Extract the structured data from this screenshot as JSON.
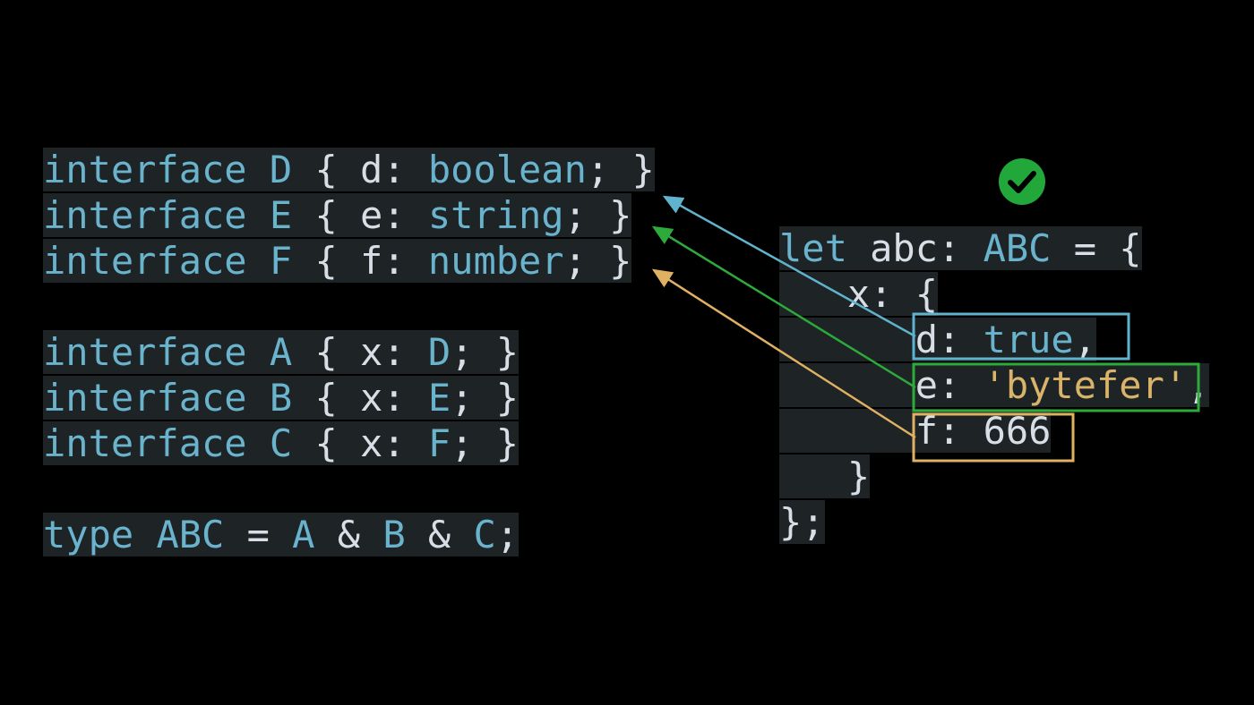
{
  "left_code": {
    "block1": [
      [
        {
          "t": "interface",
          "c": "kw"
        },
        {
          "t": " D ",
          "c": "ty"
        },
        {
          "t": "{ d: ",
          "c": "pu"
        },
        {
          "t": "boolean",
          "c": "kw"
        },
        {
          "t": "; }",
          "c": "pu"
        }
      ],
      [
        {
          "t": "interface",
          "c": "kw"
        },
        {
          "t": " E ",
          "c": "ty"
        },
        {
          "t": "{ e: ",
          "c": "pu"
        },
        {
          "t": "string",
          "c": "kw"
        },
        {
          "t": "; }",
          "c": "pu"
        }
      ],
      [
        {
          "t": "interface",
          "c": "kw"
        },
        {
          "t": " F ",
          "c": "ty"
        },
        {
          "t": "{ f: ",
          "c": "pu"
        },
        {
          "t": "number",
          "c": "kw"
        },
        {
          "t": "; }",
          "c": "pu"
        }
      ]
    ],
    "block2": [
      [
        {
          "t": "interface",
          "c": "kw"
        },
        {
          "t": " A ",
          "c": "ty"
        },
        {
          "t": "{ x: ",
          "c": "pu"
        },
        {
          "t": "D",
          "c": "ty"
        },
        {
          "t": "; }",
          "c": "pu"
        }
      ],
      [
        {
          "t": "interface",
          "c": "kw"
        },
        {
          "t": " B ",
          "c": "ty"
        },
        {
          "t": "{ x: ",
          "c": "pu"
        },
        {
          "t": "E",
          "c": "ty"
        },
        {
          "t": "; }",
          "c": "pu"
        }
      ],
      [
        {
          "t": "interface",
          "c": "kw"
        },
        {
          "t": " C ",
          "c": "ty"
        },
        {
          "t": "{ x: ",
          "c": "pu"
        },
        {
          "t": "F",
          "c": "ty"
        },
        {
          "t": "; }",
          "c": "pu"
        }
      ]
    ],
    "block3": [
      [
        {
          "t": "type",
          "c": "kw"
        },
        {
          "t": " ABC ",
          "c": "ty"
        },
        {
          "t": "= ",
          "c": "pu"
        },
        {
          "t": "A",
          "c": "ty"
        },
        {
          "t": " & ",
          "c": "pu"
        },
        {
          "t": "B",
          "c": "ty"
        },
        {
          "t": " & ",
          "c": "pu"
        },
        {
          "t": "C",
          "c": "ty"
        },
        {
          "t": ";",
          "c": "pu"
        }
      ]
    ]
  },
  "right_code": [
    [
      {
        "t": "let",
        "c": "kw"
      },
      {
        "t": " abc: ",
        "c": "pu"
      },
      {
        "t": "ABC",
        "c": "ty"
      },
      {
        "t": " = {",
        "c": "pu"
      }
    ],
    [
      {
        "t": "   x: {",
        "c": "pu"
      }
    ],
    [
      {
        "t": "      d: ",
        "c": "pu"
      },
      {
        "t": "true",
        "c": "kw"
      },
      {
        "t": ",",
        "c": "pu"
      }
    ],
    [
      {
        "t": "      e: ",
        "c": "pu"
      },
      {
        "t": "'bytefer'",
        "c": "st"
      },
      {
        "t": ",",
        "c": "pu"
      }
    ],
    [
      {
        "t": "      f: ",
        "c": "pu"
      },
      {
        "t": "666",
        "c": "nu"
      }
    ],
    [
      {
        "t": "   }",
        "c": "pu"
      }
    ],
    [
      {
        "t": "};",
        "c": "pu"
      }
    ]
  ],
  "check_icon": "check-circle-icon",
  "colors": {
    "blue": "#5fb3cd",
    "green": "#2cab3a",
    "orange": "#e0b160",
    "check": "#22a83a"
  }
}
